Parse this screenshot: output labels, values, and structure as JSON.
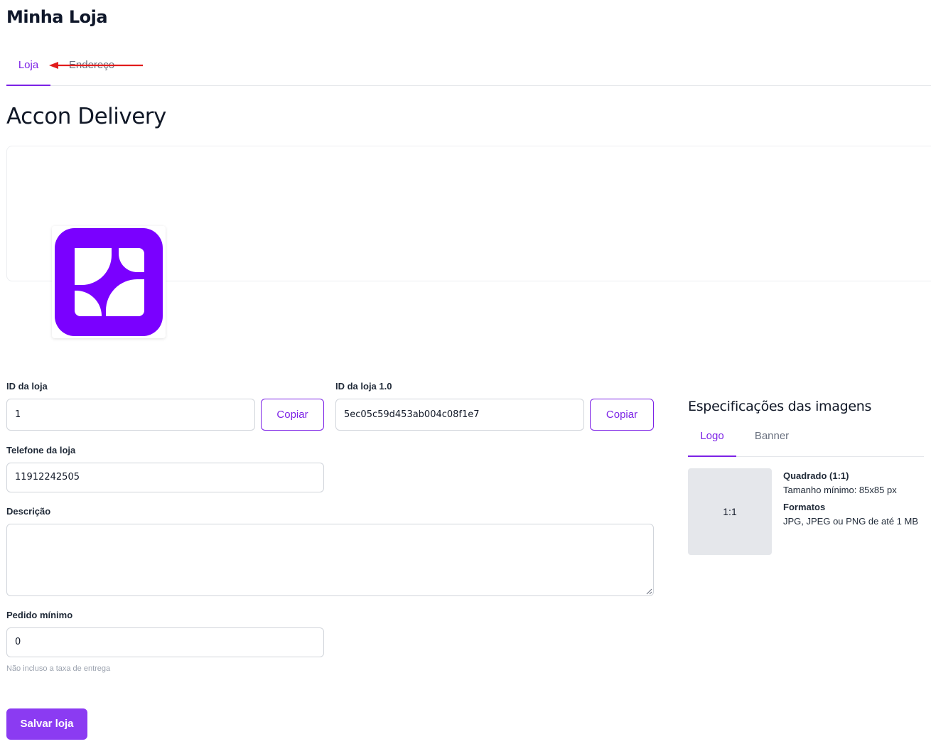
{
  "page": {
    "title": "Minha Loja"
  },
  "tabs": {
    "loja": "Loja",
    "endereco": "Endereço"
  },
  "store": {
    "name": "Accon Delivery"
  },
  "form": {
    "store_id": {
      "label": "ID da loja",
      "value": "1",
      "copy_label": "Copiar"
    },
    "store_id_v1": {
      "label": "ID da loja 1.0",
      "value": "5ec05c59d453ab004c08f1e7",
      "copy_label": "Copiar"
    },
    "phone": {
      "label": "Telefone da loja",
      "value": "11912242505"
    },
    "description": {
      "label": "Descrição",
      "value": ""
    },
    "min_order": {
      "label": "Pedido mínimo",
      "value": "0",
      "hint": "Não incluso a taxa de entrega"
    },
    "save_label": "Salvar loja"
  },
  "specs": {
    "title": "Especificações das imagens",
    "tabs": {
      "logo": "Logo",
      "banner": "Banner"
    },
    "ratio": "1:1",
    "shape": "Quadrado (1:1)",
    "min_size": "Tamanho mínimo: 85x85 px",
    "formats_label": "Formatos",
    "formats": "JPG, JPEG ou PNG de até 1 MB"
  },
  "colors": {
    "accent": "#7c22e6",
    "primary_button": "#8b3bf2",
    "logo_bg": "#7a00ff"
  },
  "icons": {
    "logo": "accon-logo-icon",
    "annotation": "red-arrow-annotation"
  }
}
